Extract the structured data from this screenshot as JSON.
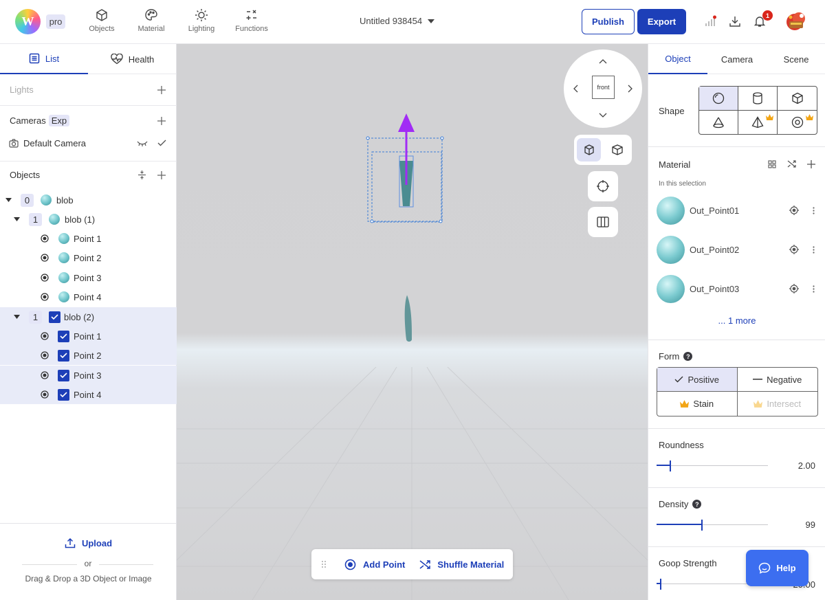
{
  "topbar": {
    "logo_letter": "W",
    "plan_badge": "pro",
    "nav": [
      {
        "label": "Objects",
        "icon": "cube-icon"
      },
      {
        "label": "Material",
        "icon": "palette-icon"
      },
      {
        "label": "Lighting",
        "icon": "sun-icon"
      },
      {
        "label": "Functions",
        "icon": "math-operators-icon"
      }
    ],
    "document_title": "Untitled 938454",
    "publish_label": "Publish",
    "export_label": "Export",
    "notification_count": "1"
  },
  "left_panel": {
    "tabs": [
      {
        "label": "List",
        "icon": "list-icon",
        "active": true
      },
      {
        "label": "Health",
        "icon": "heart-pulse-icon",
        "active": false
      }
    ],
    "lights_label": "Lights",
    "cameras_label": "Cameras",
    "cameras_badge": "Exp",
    "default_camera": "Default Camera",
    "objects_label": "Objects",
    "tree": [
      {
        "count": "0",
        "label": "blob"
      },
      {
        "count": "1",
        "label": "blob (1)"
      },
      {
        "label": "Point 1"
      },
      {
        "label": "Point 2"
      },
      {
        "label": "Point 3"
      },
      {
        "label": "Point 4"
      },
      {
        "count": "1",
        "label": "blob (2)"
      },
      {
        "label": "Point 1"
      },
      {
        "label": "Point 2"
      },
      {
        "label": "Point 3"
      },
      {
        "label": "Point 4"
      }
    ],
    "upload_label": "Upload",
    "or_label": "or",
    "drag_drop_label": "Drag & Drop a 3D Object or Image"
  },
  "viewport": {
    "view_label": "front",
    "add_point_label": "Add Point",
    "shuffle_material_label": "Shuffle Material"
  },
  "right_panel": {
    "tabs": [
      {
        "label": "Object",
        "active": true
      },
      {
        "label": "Camera",
        "active": false
      },
      {
        "label": "Scene",
        "active": false
      }
    ],
    "shape_label": "Shape",
    "shapes": [
      "sphere-icon",
      "cylinder-icon",
      "cube-icon",
      "cone-icon",
      "pyramid-icon",
      "torus-icon"
    ],
    "material_label": "Material",
    "in_selection_label": "In this selection",
    "materials": [
      "Out_Point01",
      "Out_Point02",
      "Out_Point03"
    ],
    "more_label": "... 1 more",
    "form_label": "Form",
    "form_options": [
      "Positive",
      "Negative",
      "Stain",
      "Intersect"
    ],
    "roundness": {
      "label": "Roundness",
      "value": "2.00",
      "level": 0.12
    },
    "density": {
      "label": "Density",
      "value": "99",
      "level": 0.4
    },
    "goop_strength": {
      "label": "Goop Strength",
      "value": "20.00",
      "level": 0.03
    },
    "help_label": "Help"
  },
  "colors": {
    "accent": "#1d3fb8",
    "help_button": "#3c6ef0",
    "selection_bg": "#e8ebf8",
    "arrow": "#a12cf5"
  }
}
